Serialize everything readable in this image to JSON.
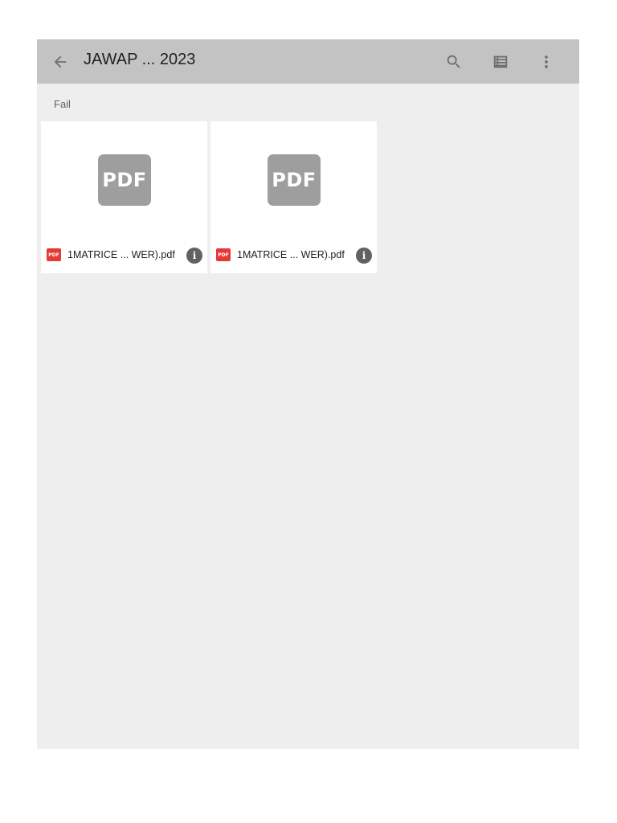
{
  "toolbar": {
    "title": "JAWAP ... 2023",
    "back_icon": "arrow-back-icon",
    "search_icon": "search-icon",
    "view_icon": "list-view-icon",
    "more_icon": "more-vert-icon",
    "bg_color": "#c3c3c3"
  },
  "section": {
    "label": "Fail"
  },
  "files": [
    {
      "thumb_text": "PDF",
      "badge_text": "PDF",
      "name": "1MATRICE ... WER).pdf",
      "badge_color": "#e53935"
    },
    {
      "thumb_text": "PDF",
      "badge_text": "PDF",
      "name": "1MATRICE ... WER).pdf",
      "badge_color": "#e53935"
    }
  ],
  "info_glyph": "i"
}
